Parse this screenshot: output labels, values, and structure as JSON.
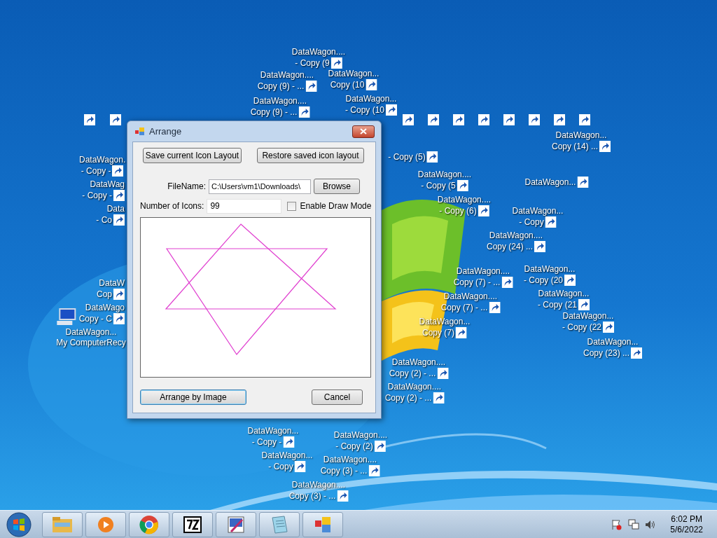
{
  "desktop_icons": [
    {
      "kind": "shortcut",
      "lines": [
        "DataWagon....",
        "- Copy (9"
      ]
    },
    {
      "kind": "shortcut",
      "lines": [
        "DataWagon....",
        "Copy (9) - ..."
      ]
    },
    {
      "kind": "shortcut",
      "lines": [
        "DataWagon...",
        "Copy (10"
      ]
    },
    {
      "kind": "shortcut",
      "lines": [
        "DataWagon....",
        "Copy (9) - ..."
      ]
    },
    {
      "kind": "shortcut",
      "lines": [
        "DataWagon...",
        "- Copy (10"
      ]
    },
    {
      "kind": "shortcut",
      "lines": [
        "DataWagon...",
        "Copy (14) ..."
      ]
    },
    {
      "kind": "shortcut",
      "lines": [
        "DataWagon.",
        "- Copy -"
      ]
    },
    {
      "kind": "shortcut",
      "lines": [
        "DataWag",
        "- Copy -"
      ]
    },
    {
      "kind": "shortcut",
      "lines": [
        "Data",
        "- Co"
      ]
    },
    {
      "kind": "shortcut",
      "lines": [
        "DataW",
        "Cop"
      ]
    },
    {
      "kind": "shortcut",
      "lines": [
        "DataWago",
        "Copy - C"
      ]
    },
    {
      "kind": "computer",
      "lines": [
        "DataWagon...",
        "My ComputerRecy"
      ]
    },
    {
      "kind": "shortcut",
      "lines": [
        "- Copy (5)"
      ]
    },
    {
      "kind": "shortcut",
      "lines": [
        "DataWagon....",
        "- Copy (5"
      ]
    },
    {
      "kind": "shortcut",
      "lines": [
        "DataWagon..."
      ]
    },
    {
      "kind": "shortcut",
      "lines": [
        "DataWagon....",
        "- Copy (6)"
      ]
    },
    {
      "kind": "shortcut",
      "lines": [
        "DataWagon...",
        "- Copy"
      ]
    },
    {
      "kind": "shortcut",
      "lines": [
        "DataWagon....",
        "Copy (24) ..."
      ]
    },
    {
      "kind": "shortcut",
      "lines": [
        "DataWagon....",
        "Copy (7) - ..."
      ]
    },
    {
      "kind": "shortcut",
      "lines": [
        "DataWagon...",
        "- Copy (20"
      ]
    },
    {
      "kind": "shortcut",
      "lines": [
        "DataWagon....",
        "Copy (7) - ..."
      ]
    },
    {
      "kind": "shortcut",
      "lines": [
        "DataWagon...",
        "- Copy (21"
      ]
    },
    {
      "kind": "shortcut",
      "lines": [
        "DataWagon...",
        "- Copy (22"
      ]
    },
    {
      "kind": "shortcut",
      "lines": [
        "DataWagon...",
        "Copy (7)"
      ]
    },
    {
      "kind": "shortcut",
      "lines": [
        "DataWagon...",
        "Copy (23) ..."
      ]
    },
    {
      "kind": "shortcut",
      "lines": [
        "DataWagon....",
        "Copy (2) - ..."
      ]
    },
    {
      "kind": "shortcut",
      "lines": [
        "DataWagon....",
        "Copy (2) - ..."
      ]
    },
    {
      "kind": "shortcut",
      "lines": [
        "DataWagon...",
        "- Copy -"
      ]
    },
    {
      "kind": "shortcut",
      "lines": [
        "DataWagon....",
        "- Copy (2)"
      ]
    },
    {
      "kind": "shortcut",
      "lines": [
        "DataWagon...",
        "- Copy"
      ]
    },
    {
      "kind": "shortcut",
      "lines": [
        "DataWagon....",
        "Copy (3) - ..."
      ]
    },
    {
      "kind": "shortcut",
      "lines": [
        "DataWagon....",
        "Copy (3) - ..."
      ]
    }
  ],
  "dialog": {
    "title": "Arrange",
    "save_button": "Save current Icon Layout",
    "restore_button": "Restore saved icon layout",
    "filename": {
      "label": "FileName:",
      "value": "C:\\Users\\vm1\\Downloads\\"
    },
    "browse_button": "Browse",
    "icon_count": {
      "label": "Number of Icons:",
      "value": "99"
    },
    "draw_mode": {
      "label": "Enable Draw Mode",
      "checked": false
    },
    "arrange_button": "Arrange by Image",
    "cancel_button": "Cancel"
  },
  "taskbar": {
    "time": "6:02 PM",
    "date": "5/6/2022"
  }
}
